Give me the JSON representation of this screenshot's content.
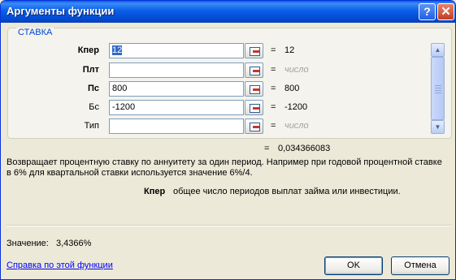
{
  "window": {
    "title": "Аргументы функции",
    "help_glyph": "?",
    "close_glyph": "✕"
  },
  "group": {
    "label": "СТАВКА"
  },
  "args": [
    {
      "label": "Кпер",
      "value": "12",
      "result": "12"
    },
    {
      "label": "Плт",
      "value": "",
      "result": "число"
    },
    {
      "label": "Пс",
      "value": "800",
      "result": "800"
    },
    {
      "label": "Бс",
      "value": "-1200",
      "result": "-1200"
    },
    {
      "label": "Тип",
      "value": "",
      "result": "число"
    }
  ],
  "equals": "=",
  "result": {
    "value": "0,034366083"
  },
  "description": {
    "line1": "Возвращает процентную ставку по аннуитету за один период. Например при годовой процентной ставке",
    "line2": "в 6% для квартальной ставки используется значение 6%/4."
  },
  "arg_help": {
    "name": "Кпер",
    "text": "общее число периодов выплат займа или инвестиции."
  },
  "value_line": {
    "label": "Значение:",
    "value": "3,4366%"
  },
  "help_link": "Справка по этой функции",
  "buttons": {
    "ok": "OK",
    "cancel": "Отмена"
  },
  "scrollbar": {
    "up": "▲",
    "down": "▼"
  }
}
